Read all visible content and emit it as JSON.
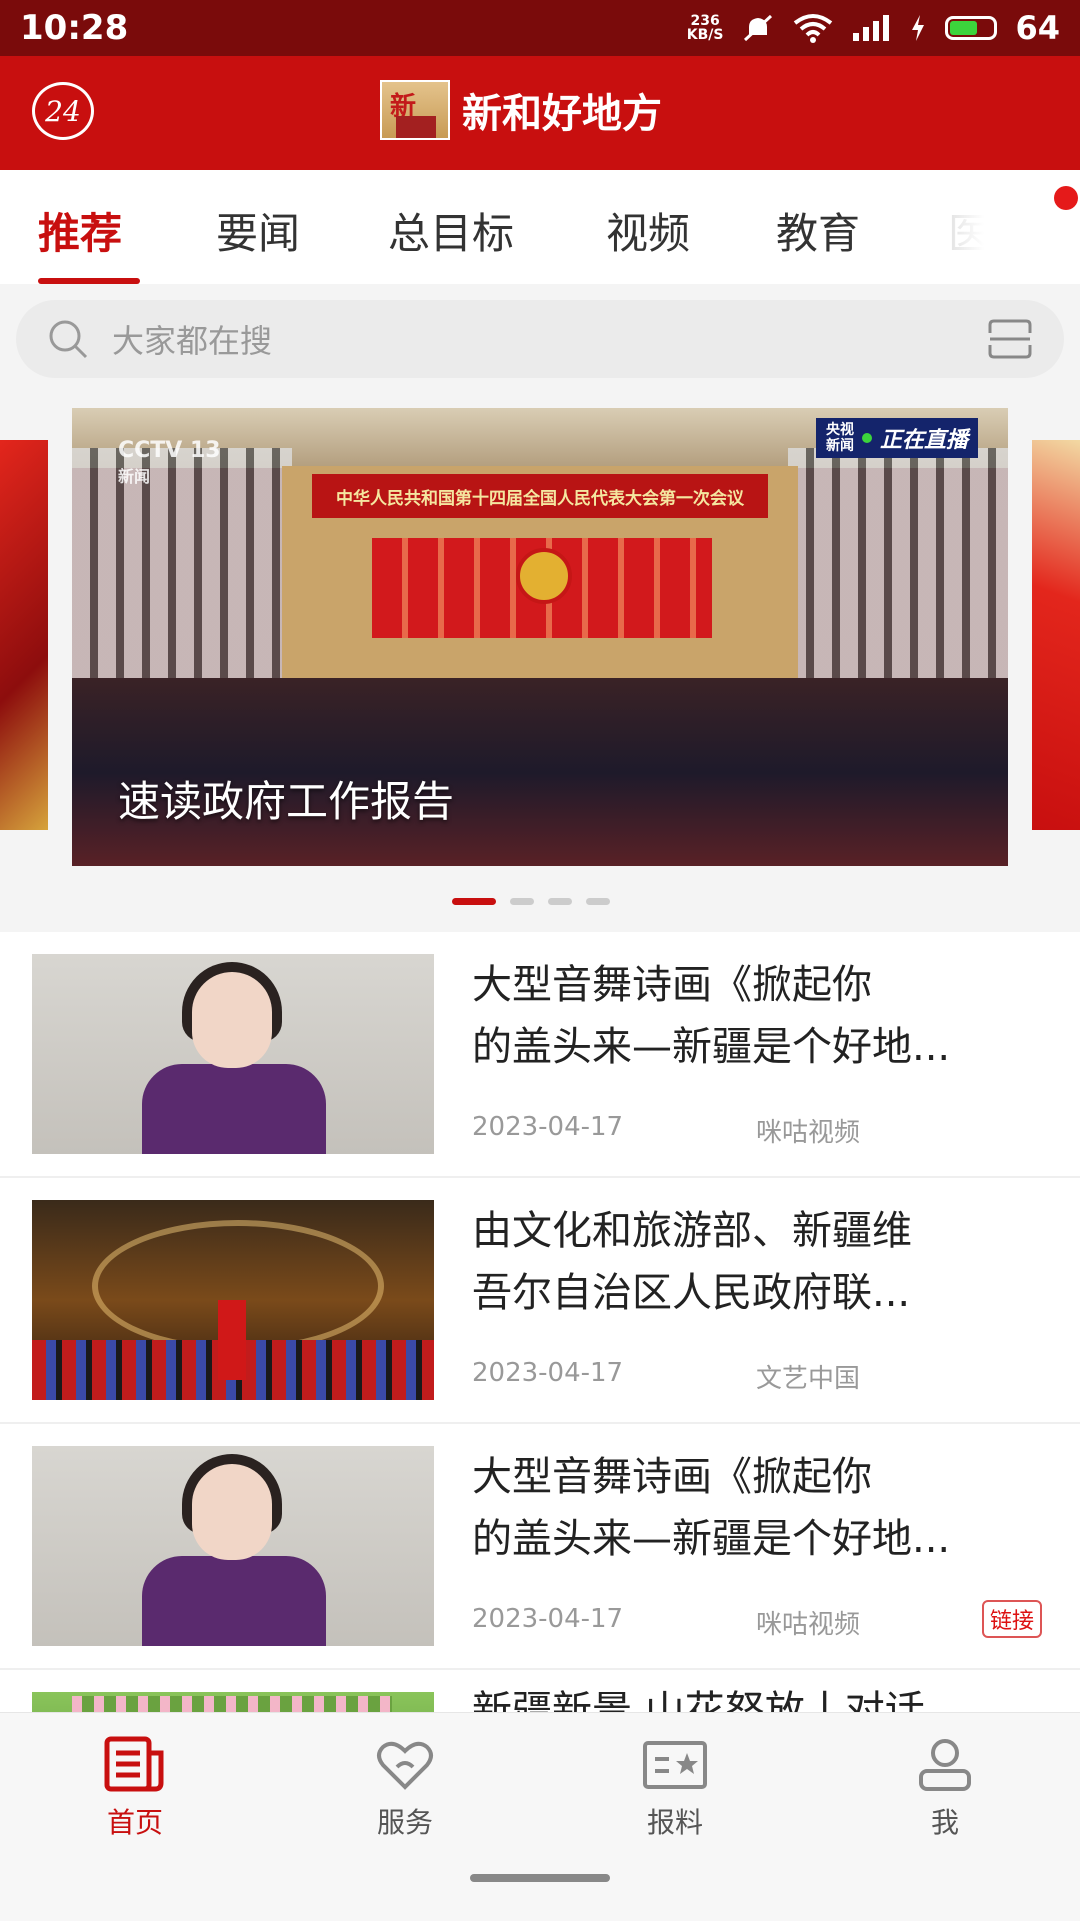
{
  "status_bar": {
    "time": "10:28",
    "net_speed_value": "236",
    "net_speed_unit": "KB/S",
    "battery_level": "64",
    "icons": [
      "mute-icon",
      "wifi-icon",
      "signal-icon",
      "charging-icon",
      "battery-icon"
    ]
  },
  "header": {
    "badge": "24",
    "logo_mark": "新",
    "app_name": "新和好地方"
  },
  "tabs": [
    {
      "label": "推荐",
      "active": true
    },
    {
      "label": "要闻"
    },
    {
      "label": "总目标"
    },
    {
      "label": "视频"
    },
    {
      "label": "教育"
    },
    {
      "label": "医卄"
    }
  ],
  "search": {
    "placeholder": "大家都在搜",
    "icon": "search-icon",
    "right_icon": "scan-icon"
  },
  "banner": {
    "channel_logo": "CCTV 13",
    "channel_sub": "新闻",
    "live_source": "央视\n新闻",
    "live_label": "正在直播",
    "stage_text": "中华人民共和国第十四届全国人民代表大会第一次会议",
    "caption": "速读政府工作报告",
    "page_count": 4,
    "active_page": 1
  },
  "news": [
    {
      "title_line1": "大型音舞诗画《掀起你",
      "title_line2": "的盖头来—新疆是个好地...",
      "date": "2023-04-17",
      "source": "咪咕视频",
      "tag": ""
    },
    {
      "title_line1": "由文化和旅游部、新疆维",
      "title_line2": "吾尔自治区人民政府联...",
      "date": "2023-04-17",
      "source": "文艺中国",
      "tag": ""
    },
    {
      "title_line1": "大型音舞诗画《掀起你",
      "title_line2": "的盖头来—新疆是个好地...",
      "date": "2023-04-17",
      "source": "咪咕视频",
      "tag": "链接"
    },
    {
      "title_line1": "新疆新景 山花怒放丨对话",
      "title_line2": "",
      "date": "",
      "source": "",
      "tag": ""
    }
  ],
  "bottom_nav": [
    {
      "label": "首页",
      "icon": "news-icon",
      "active": true
    },
    {
      "label": "服务",
      "icon": "heart-icon"
    },
    {
      "label": "报料",
      "icon": "report-card-icon"
    },
    {
      "label": "我",
      "icon": "person-icon"
    }
  ],
  "colors": {
    "brand_red": "#c80f0f",
    "status_bar": "#7a0b0b"
  }
}
